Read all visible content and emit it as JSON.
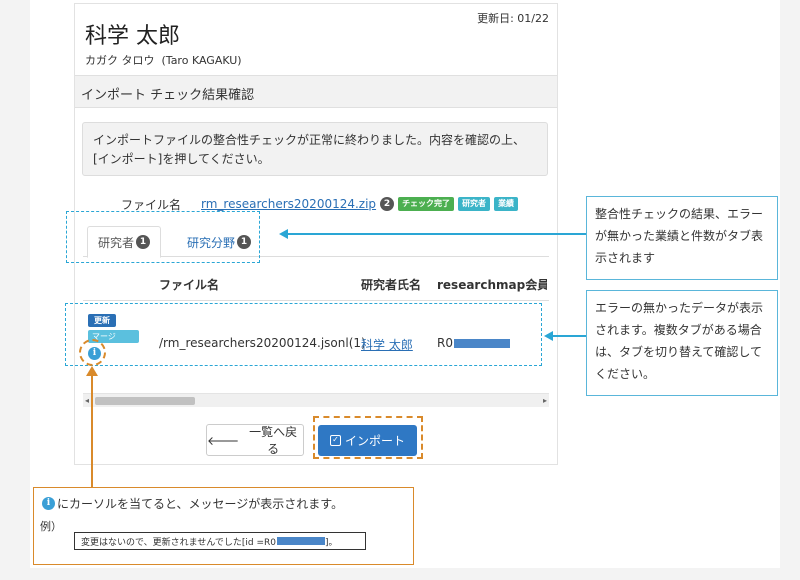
{
  "updated": "更新日: 01/22",
  "researcher": {
    "name": "科学 太郎",
    "kana": "カガク タロウ",
    "roman": "(Taro KAGAKU)"
  },
  "section_title": "インポート チェック結果確認",
  "alert_text": "インポートファイルの整合性チェックが正常に終わりました。内容を確認の上、[インポート]を押してください。",
  "file": {
    "label": "ファイル名",
    "link": "rm_researchers20200124.zip",
    "count": "2",
    "tags": [
      "チェック完了",
      "研究者",
      "業績"
    ]
  },
  "tabs": [
    {
      "label": "研究者",
      "count": "1"
    },
    {
      "label": "研究分野",
      "count": "1"
    }
  ],
  "table": {
    "headers": [
      "ファイル名",
      "研究者氏名",
      "researchmap会員ID"
    ],
    "row": {
      "badge_update": "更新",
      "badge_merge": "マージ",
      "info_glyph": "i",
      "file": "/rm_researchers20200124.jsonl(1)",
      "name": "科学 太郎",
      "id_prefix": "R0"
    }
  },
  "scroll": {
    "left_glyph": "◂",
    "right_glyph": "▸"
  },
  "buttons": {
    "back": "一覧へ戻る",
    "back_glyph": "🡐",
    "import": "インポート",
    "import_glyph": "✓"
  },
  "callouts": {
    "tabs_note": "整合性チェックの結果、エラーが無かった業績と件数がタブ表示されます",
    "data_note": "エラーの無かったデータが表示されます。複数タブがある場合は、タブを切り替えて確認してください。",
    "hover_note": "にカーソルを当てると、メッセージが表示されます。",
    "example_label": "例）",
    "tooltip_text": "変更はないので、更新されませんでした[id =R0",
    "tooltip_end": "]。"
  },
  "colors": {
    "link": "#2a6fb5",
    "primary": "#2f78c4",
    "annotation_blue": "#2aa6d5",
    "annotation_orange": "#d98a2b"
  }
}
